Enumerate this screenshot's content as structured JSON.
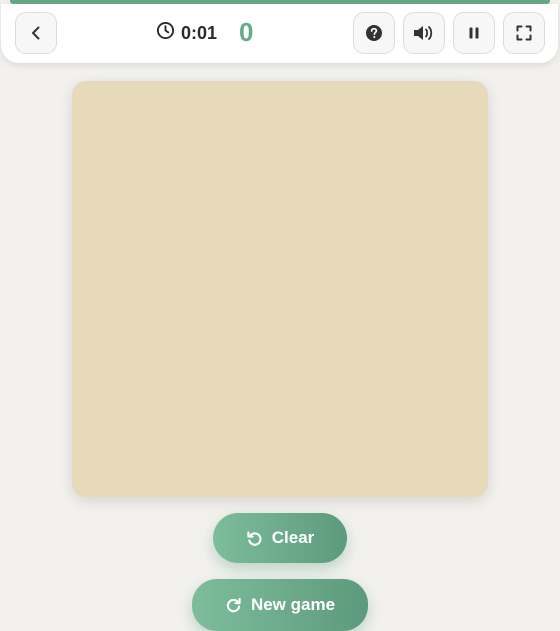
{
  "header": {
    "timer": "0:01",
    "score": "0",
    "icons": {
      "back": "chevron-left-icon",
      "timer": "clock-icon",
      "help": "help-icon",
      "sound": "volume-icon",
      "pause": "pause-icon",
      "fullscreen": "fullscreen-icon"
    }
  },
  "actions": {
    "clear_label": "Clear",
    "new_game_label": "New game",
    "clear_icon": "undo-icon",
    "new_game_icon": "refresh-icon"
  },
  "colors": {
    "accent": "#6aa88a",
    "board": "#e6dabb",
    "background": "#f2f1ee"
  }
}
